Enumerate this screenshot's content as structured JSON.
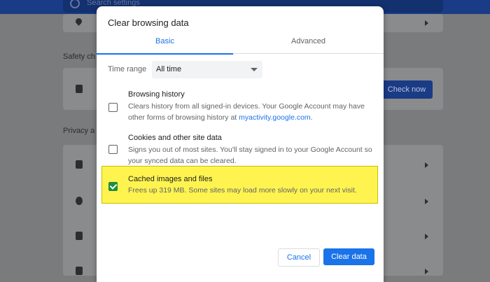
{
  "background": {
    "search_placeholder": "Search settings",
    "safety_check_label": "Safety ch",
    "privacy_label": "Privacy a",
    "check_now_label": "Check now"
  },
  "dialog": {
    "title": "Clear browsing data",
    "tabs": [
      {
        "label": "Basic",
        "selected": true
      },
      {
        "label": "Advanced",
        "selected": false
      }
    ],
    "time_range": {
      "label": "Time range",
      "value": "All time"
    },
    "options": [
      {
        "title": "Browsing history",
        "desc_before_link": "Clears history from all signed-in devices. Your Google Account may have other forms of browsing history at ",
        "link": "myactivity.google.com",
        "desc_after_link": ".",
        "checked": false
      },
      {
        "title": "Cookies and other site data",
        "desc": "Signs you out of most sites. You'll stay signed in to your Google Account so your synced data can be cleared.",
        "checked": false
      },
      {
        "title": "Cached images and files",
        "desc": "Frees up 319 MB. Some sites may load more slowly on your next visit.",
        "checked": true,
        "highlight_color": "#fff44f"
      }
    ],
    "cancel_label": "Cancel",
    "clear_label": "Clear data"
  },
  "colors": {
    "accent": "#1a73e8",
    "checked": "#1e8e3e",
    "highlight": "#fff44f"
  }
}
